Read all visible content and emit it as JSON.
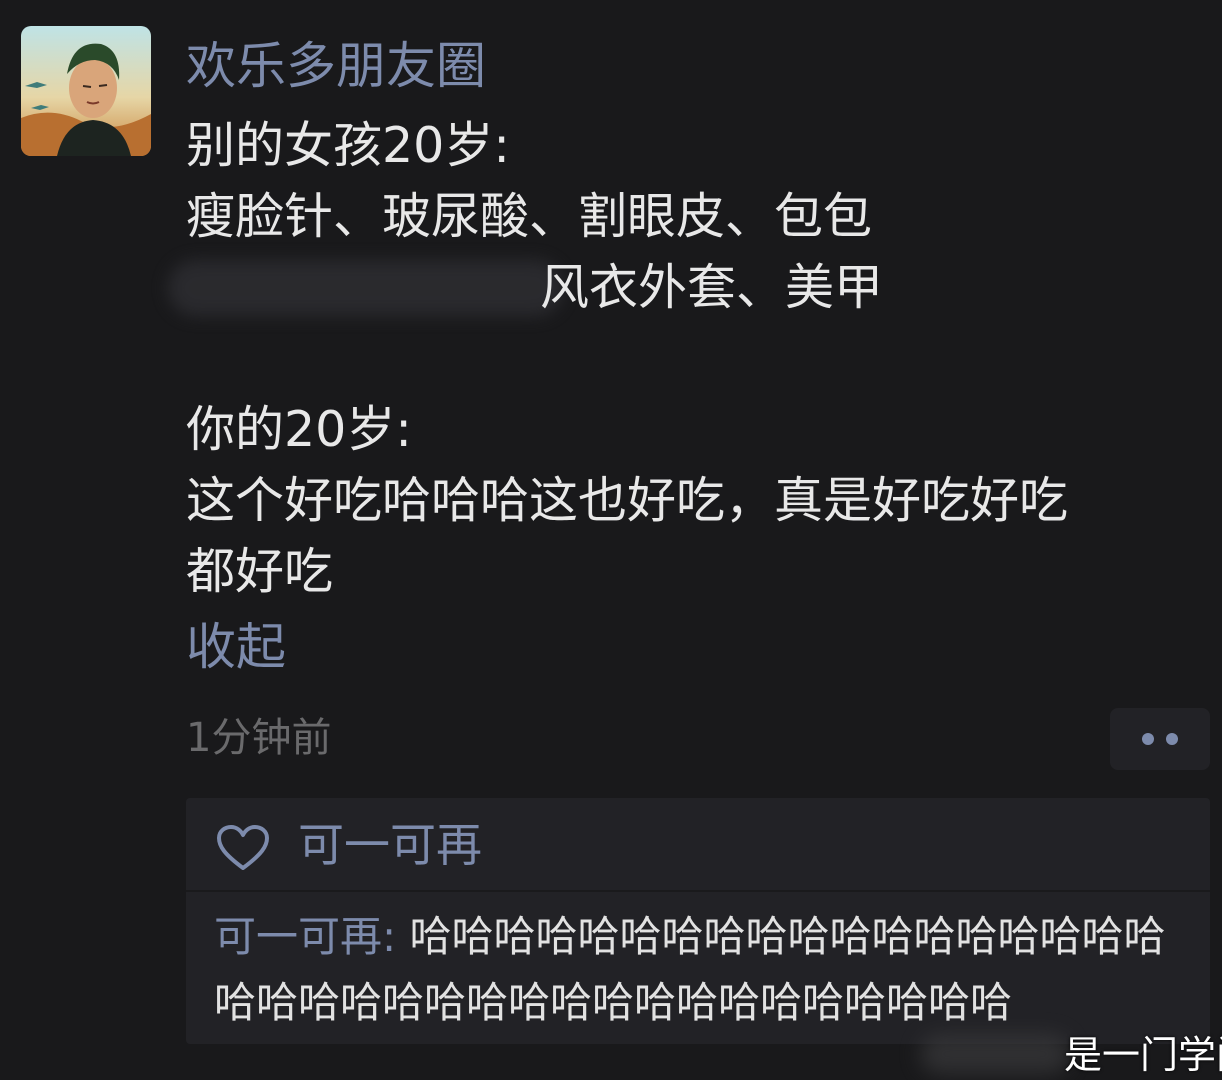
{
  "post": {
    "author": "欢乐多朋友圈",
    "lines": [
      "别的女孩20岁:",
      "瘦脸针、玻尿酸、割眼皮、包包",
      "风衣外套、美甲",
      "",
      "你的20岁:",
      "这个好吃哈哈哈这也好吃，真是好吃好吃",
      "都好吃"
    ],
    "collapse_label": "收起",
    "timestamp": "1分钟前"
  },
  "interactions": {
    "liker": "可一可再",
    "comment_author": "可一可再",
    "comment_separator": ": ",
    "comment_text": "哈哈哈哈哈哈哈哈哈哈哈哈哈哈哈哈哈哈哈哈哈哈哈哈哈哈哈哈哈哈哈哈哈哈哈哈哈"
  },
  "watermark": "是一门学问",
  "colors": {
    "background": "#19191b",
    "link_blue": "#7d8bac",
    "panel": "#222226"
  },
  "icons": {
    "like": "heart-outline-icon",
    "more": "more-dots-icon"
  }
}
